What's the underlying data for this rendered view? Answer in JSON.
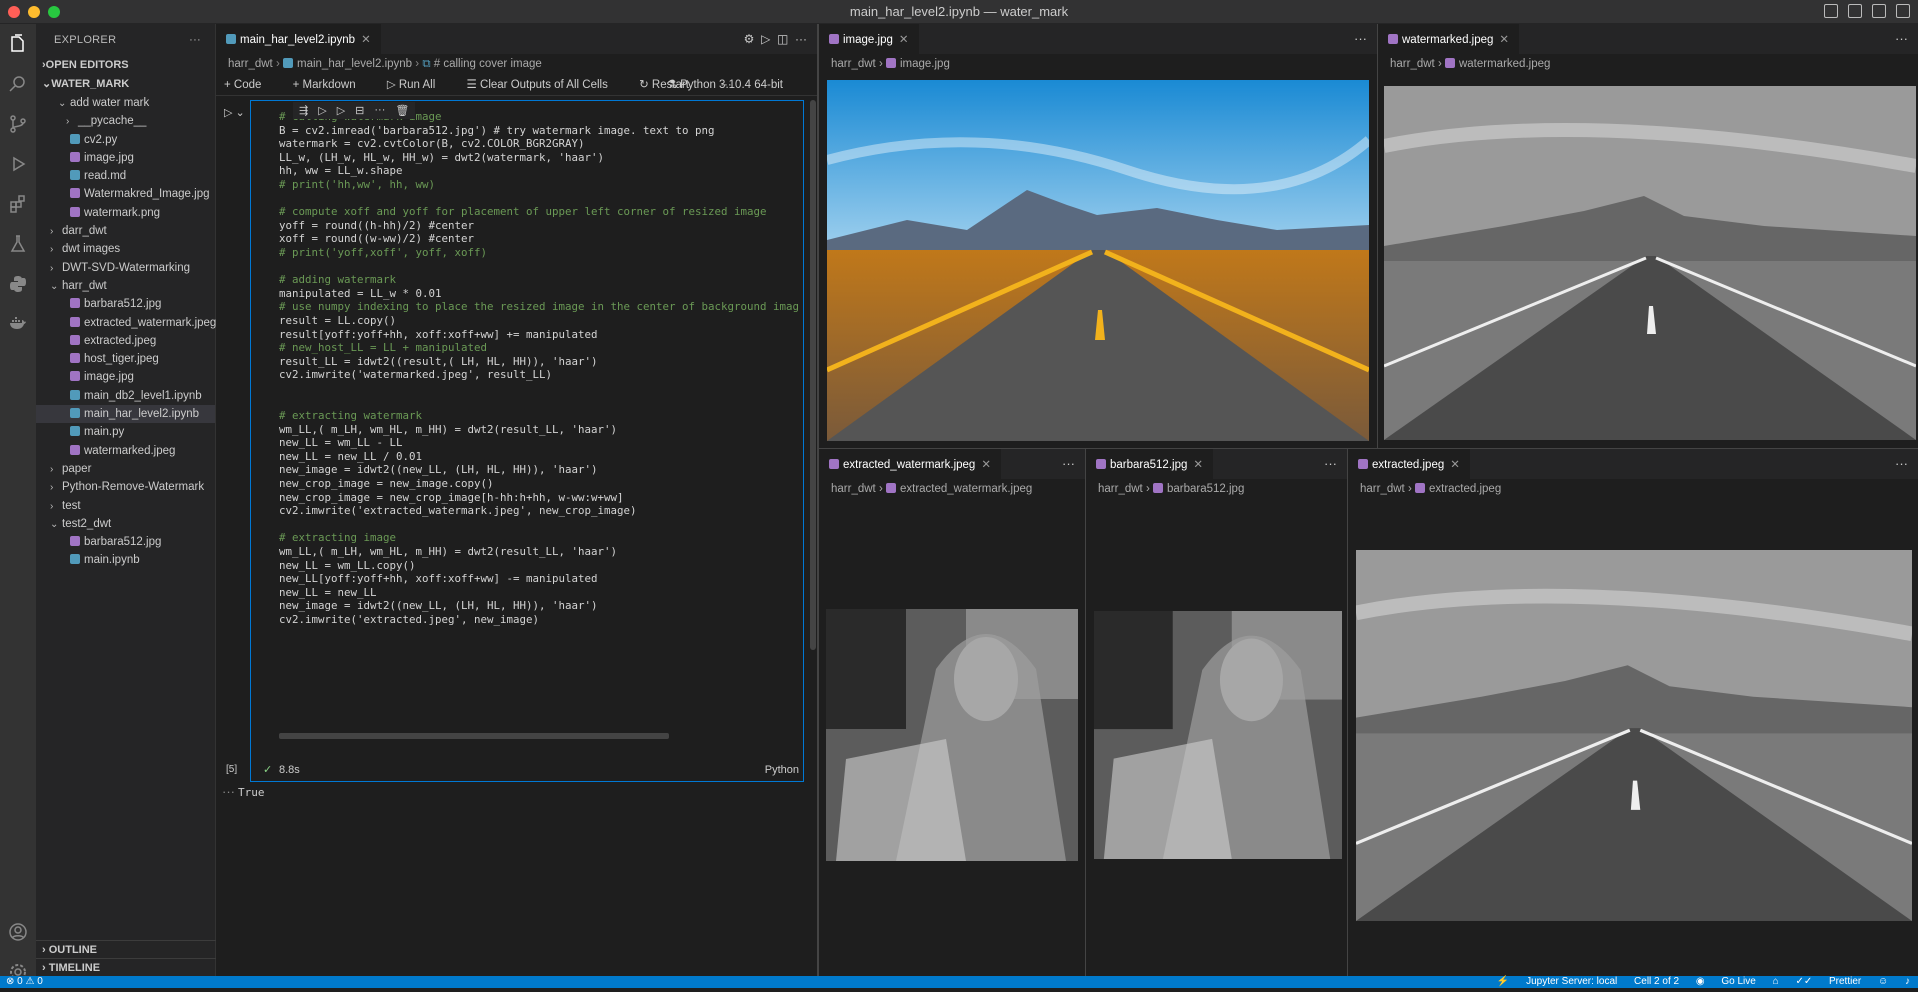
{
  "window": {
    "title": "main_har_level2.ipynb — water_mark"
  },
  "sidebar": {
    "header": "EXPLORER",
    "open_editors": "OPEN EDITORS",
    "root": "WATER_MARK",
    "items": [
      {
        "label": "add water mark",
        "type": "folder-open",
        "indent": 1
      },
      {
        "label": "__pycache__",
        "type": "folder",
        "indent": 2
      },
      {
        "label": "cv2.py",
        "type": "py",
        "indent": 1
      },
      {
        "label": "image.jpg",
        "type": "img",
        "indent": 1
      },
      {
        "label": "read.md",
        "type": "md",
        "indent": 1
      },
      {
        "label": "Watermakred_Image.jpg",
        "type": "img",
        "indent": 1
      },
      {
        "label": "watermark.png",
        "type": "img",
        "indent": 1
      },
      {
        "label": "darr_dwt",
        "type": "folder",
        "indent": 0
      },
      {
        "label": "dwt images",
        "type": "folder",
        "indent": 0
      },
      {
        "label": "DWT-SVD-Watermarking",
        "type": "folder",
        "indent": 0
      },
      {
        "label": "harr_dwt",
        "type": "folder-open",
        "indent": 0
      },
      {
        "label": "barbara512.jpg",
        "type": "img",
        "indent": 1
      },
      {
        "label": "extracted_watermark.jpeg",
        "type": "img",
        "indent": 1
      },
      {
        "label": "extracted.jpeg",
        "type": "img",
        "indent": 1
      },
      {
        "label": "host_tiger.jpeg",
        "type": "img",
        "indent": 1
      },
      {
        "label": "image.jpg",
        "type": "img",
        "indent": 1
      },
      {
        "label": "main_db2_level1.ipynb",
        "type": "nb",
        "indent": 1
      },
      {
        "label": "main_har_level2.ipynb",
        "type": "nb",
        "indent": 1,
        "selected": true
      },
      {
        "label": "main.py",
        "type": "py",
        "indent": 1
      },
      {
        "label": "watermarked.jpeg",
        "type": "img",
        "indent": 1
      },
      {
        "label": "paper",
        "type": "folder",
        "indent": 0
      },
      {
        "label": "Python-Remove-Watermark",
        "type": "folder",
        "indent": 0
      },
      {
        "label": "test",
        "type": "folder",
        "indent": 0
      },
      {
        "label": "test2_dwt",
        "type": "folder-open",
        "indent": 0
      },
      {
        "label": "barbara512.jpg",
        "type": "img",
        "indent": 1
      },
      {
        "label": "main.ipynb",
        "type": "nb",
        "indent": 1
      }
    ],
    "outline": "OUTLINE",
    "timeline": "TIMELINE"
  },
  "editor": {
    "tab": "main_har_level2.ipynb",
    "breadcrumb": [
      "harr_dwt",
      "main_har_level2.ipynb",
      "# calling cover image"
    ],
    "toolbar": {
      "code": "Code",
      "markdown": "Markdown",
      "run_all": "Run All",
      "clear": "Clear Outputs of All Cells",
      "restart": "Restart",
      "kernel": "Python 3.10.4 64-bit"
    },
    "cell": {
      "exec_count": "[5]",
      "time": "8.8s",
      "lang": "Python",
      "lines": [
        "# calling watermark image",
        "B = cv2.imread('barbara512.jpg') # try watermark image. text to png",
        "watermark = cv2.cvtColor(B, cv2.COLOR_BGR2GRAY)",
        "LL_w, (LH_w, HL_w, HH_w) = dwt2(watermark, 'haar')",
        "hh, ww = LL_w.shape",
        "# print('hh,ww', hh, ww)",
        "",
        "# compute xoff and yoff for placement of upper left corner of resized image",
        "yoff = round((h-hh)/2) #center",
        "xoff = round((w-ww)/2) #center",
        "# print('yoff,xoff', yoff, xoff)",
        "",
        "# adding watermark",
        "manipulated = LL_w * 0.01",
        "# use numpy indexing to place the resized image in the center of background imag",
        "result = LL.copy()",
        "result[yoff:yoff+hh, xoff:xoff+ww] += manipulated",
        "# new_host_LL = LL + manipulated",
        "result_LL = idwt2((result,( LH, HL, HH)), 'haar')",
        "cv2.imwrite('watermarked.jpeg', result_LL)",
        "",
        "",
        "# extracting watermark",
        "wm_LL,( m_LH, wm_HL, m_HH) = dwt2(result_LL, 'haar')",
        "new_LL = wm_LL - LL",
        "new_LL = new_LL / 0.01",
        "new_image = idwt2((new_LL, (LH, HL, HH)), 'haar')",
        "new_crop_image = new_image.copy()",
        "new_crop_image = new_crop_image[h-hh:h+hh, w-ww:w+ww]",
        "cv2.imwrite('extracted_watermark.jpeg', new_crop_image)",
        "",
        "# extracting image",
        "wm_LL,( m_LH, wm_HL, m_HH) = dwt2(result_LL, 'haar')",
        "new_LL = wm_LL.copy()",
        "new_LL[yoff:yoff+hh, xoff:xoff+ww] -= manipulated",
        "new_LL = new_LL",
        "new_image = idwt2((new_LL, (LH, HL, HH)), 'haar')",
        "cv2.imwrite('extracted.jpeg', new_image)"
      ],
      "output": "True"
    }
  },
  "panes": {
    "image": {
      "tab": "image.jpg",
      "bc": [
        "harr_dwt",
        "image.jpg"
      ]
    },
    "watermarked": {
      "tab": "watermarked.jpeg",
      "bc": [
        "harr_dwt",
        "watermarked.jpeg"
      ]
    },
    "extracted_wm": {
      "tab": "extracted_watermark.jpeg",
      "bc": [
        "harr_dwt",
        "extracted_watermark.jpeg"
      ]
    },
    "barbara": {
      "tab": "barbara512.jpg",
      "bc": [
        "harr_dwt",
        "barbara512.jpg"
      ]
    },
    "extracted": {
      "tab": "extracted.jpeg",
      "bc": [
        "harr_dwt",
        "extracted.jpeg"
      ]
    }
  },
  "status": {
    "errors": "0",
    "warnings": "0",
    "jupyter": "Jupyter Server: local",
    "cell": "Cell 2 of 2",
    "golive": "Go Live",
    "prettier": "Prettier"
  },
  "colors": {
    "accent": "#007acc",
    "selection": "#37373d"
  }
}
